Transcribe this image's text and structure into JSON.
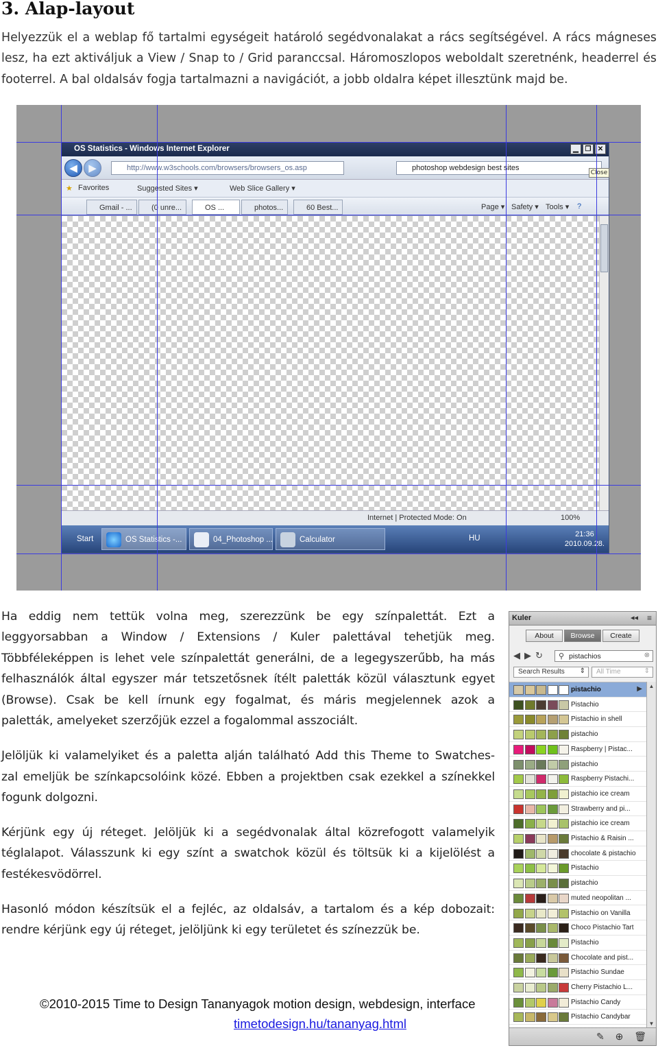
{
  "heading": "3. Alap-layout",
  "intro": [
    "Helyezzük el a weblap fő tartalmi egységeit határoló segédvonalakat a rács segítségével. A rács mágneses",
    "lesz, ha ezt aktiváljuk a View / Snap to / Grid paranccsal. Háromoszlopos weboldalt szeretnénk, headerrel és",
    "footerrel. A bal oldalsáv fogja tartalmazni a navigációt, a jobb oldalra képet illesztünk majd be."
  ],
  "screenshot": {
    "window_title": "OS Statistics - Windows Internet Explorer",
    "address": "http://www.w3schools.com/browsers/browsers_os.asp",
    "search_text": "photoshop webdesign best sites",
    "close_tooltip": "Close",
    "favorites": [
      "Favorites",
      "Suggested Sites ▾",
      "Web Slice Gallery ▾"
    ],
    "tabs": [
      "Gmail - ...",
      "(0 unre...",
      "OS ...",
      "photos...",
      "60 Best..."
    ],
    "commands": [
      "Page ▾",
      "Safety ▾",
      "Tools ▾"
    ],
    "status_zone": "Internet | Protected Mode: On",
    "status_zoom": "100%",
    "taskbar": {
      "start": "Start",
      "items": [
        "OS Statistics -...",
        "04_Photoshop ...",
        "Calculator"
      ],
      "lang": "HU",
      "time": "21:36",
      "date": "2010.09.28."
    }
  },
  "paragraphs": [
    [
      "Ha eddig nem tettük volna meg, szerezzünk be egy színpalettát. Ezt a",
      "leggyorsabban a Window / Extensions / Kuler palettával tehetjük meg.",
      "Többféleképpen is lehet vele színpalettát generálni, de a legegyszerűbb, ha más",
      "felhasználók által egyszer már tetszetősnek ítélt paletták közül választunk egyet",
      "(Browse). Csak be kell írnunk egy fogalmat, és máris megjelennek azok a",
      "paletták, amelyeket szerzőjük ezzel a fogalommal asszociált."
    ],
    [
      "Jelöljük ki valamelyiket és a paletta alján található Add this Theme to Swatches-",
      "zal emeljük be színkapcsolóink közé. Ebben a projektben csak ezekkel a színekkel",
      "fogunk dolgozni."
    ],
    [
      "Kérjünk egy új réteget. Jelöljük ki a segédvonalak által közrefogott valamelyik",
      "téglalapot. Válasszunk ki egy színt a swatchok közül és töltsük ki a kijelölést a",
      "festékesvödörrel."
    ],
    [
      "Hasonló módon készítsük el a fejléc, az oldalsáv, a tartalom és a kép dobozait:",
      "rendre kérjünk egy új réteget, jelöljünk ki egy területet és színezzük be."
    ]
  ],
  "kuler": {
    "panel_title": "Kuler",
    "panel_arrows": "◂◂",
    "tabs": [
      "About",
      "Browse",
      "Create"
    ],
    "selected_tab": "Browse",
    "search_value": "pistachios",
    "filter_left": "Search Results",
    "filter_right": "All Time",
    "themes": [
      {
        "name": "pistachio",
        "colors": [
          "#d6c9a8",
          "#d9c79a",
          "#c8b98f",
          "#ffffff",
          "#ffffff"
        ]
      },
      {
        "name": "Pistachio",
        "colors": [
          "#3d5020",
          "#6f7a2c",
          "#4b3d32",
          "#7a4b5a",
          "#c9c8a6"
        ]
      },
      {
        "name": "Pistachio in shell",
        "colors": [
          "#9a9a3a",
          "#8a8a2c",
          "#b8a25a",
          "#b59f72",
          "#d4c694"
        ]
      },
      {
        "name": "pistachio",
        "colors": [
          "#c3d27c",
          "#b9ca6e",
          "#a3b55a",
          "#8da04a",
          "#6f8236"
        ]
      },
      {
        "name": "Raspberry | Pistac...",
        "colors": [
          "#e81b7a",
          "#c20d5e",
          "#8ad321",
          "#6fc11b",
          "#f5f3ea"
        ]
      },
      {
        "name": "pistachio",
        "colors": [
          "#7d8f6c",
          "#9aab85",
          "#6a7a5b",
          "#c1cba8",
          "#8fa07a"
        ]
      },
      {
        "name": "Raspberry Pistachi...",
        "colors": [
          "#a3c94a",
          "#e3e3d8",
          "#d02a6b",
          "#f2f2ec",
          "#8dbb3a"
        ]
      },
      {
        "name": "pistachio ice cream",
        "colors": [
          "#c6dc8e",
          "#a8c85f",
          "#94b44a",
          "#7f9f3a",
          "#f0f1d0"
        ]
      },
      {
        "name": "Strawberry and pi...",
        "colors": [
          "#c9342f",
          "#e8b7a8",
          "#9dc55b",
          "#6a9a3a",
          "#f2efe0"
        ]
      },
      {
        "name": "pistachio ice cream",
        "colors": [
          "#4d6d2a",
          "#8ab04a",
          "#c6d88a",
          "#f2f1d0",
          "#a8c26a"
        ]
      },
      {
        "name": "Pistachio & Raisin ...",
        "colors": [
          "#b7d06a",
          "#8a3a5a",
          "#e8e4c8",
          "#b79a6a",
          "#6a7a3a"
        ]
      },
      {
        "name": "chocolate & pistachio",
        "colors": [
          "#1f1a16",
          "#9fb86a",
          "#cfd8a8",
          "#f0ede0",
          "#4a3a2a"
        ]
      },
      {
        "name": "Pistachio",
        "colors": [
          "#a9d25a",
          "#8ec047",
          "#d5e89a",
          "#f3f6d8",
          "#6a9a2a"
        ]
      },
      {
        "name": "pistachio",
        "colors": [
          "#dbe6b4",
          "#b9cc8a",
          "#9cb06a",
          "#7a8f4a",
          "#5a6f3a"
        ]
      },
      {
        "name": "muted neopolitan ...",
        "colors": [
          "#6b8a3a",
          "#b63a3a",
          "#2a1f1a",
          "#d9c9a8",
          "#e8d6c8"
        ]
      },
      {
        "name": "Pistachio on Vanilla",
        "colors": [
          "#93a84a",
          "#c7d38a",
          "#e8e8c8",
          "#f2efd8",
          "#b2c26a"
        ]
      },
      {
        "name": "Choco Pistachio Tart",
        "colors": [
          "#3a2a1f",
          "#5a4a2a",
          "#7a8f4a",
          "#a9b86a",
          "#2a1f16"
        ]
      },
      {
        "name": "Pistachio",
        "colors": [
          "#a0b85a",
          "#88a04a",
          "#c8d89a",
          "#6a8a3a",
          "#e4ecc8"
        ]
      },
      {
        "name": "Chocolate and pist...",
        "colors": [
          "#6a7a3a",
          "#9aaa5a",
          "#3a2a1f",
          "#c8c89a",
          "#7a5a3a"
        ]
      },
      {
        "name": "Pistachio Sundae",
        "colors": [
          "#8fb84a",
          "#f2f2e0",
          "#c8dca0",
          "#6a9a3a",
          "#e8e0c8"
        ]
      },
      {
        "name": "Cherry Pistachio L...",
        "colors": [
          "#c9d2a0",
          "#e8ecd0",
          "#b8c888",
          "#9aaa6a",
          "#c83a3a"
        ]
      },
      {
        "name": "Pistachio Candy",
        "colors": [
          "#6a8f3a",
          "#b2c86a",
          "#e0d04a",
          "#c87a9a",
          "#f2ecd8"
        ]
      },
      {
        "name": "Pistachio Candybar",
        "colors": [
          "#a8b85a",
          "#c8b86a",
          "#8a6a3a",
          "#d8c88a",
          "#6a7a3a"
        ]
      }
    ],
    "footer_icons": "✎ ⊕ 🗑"
  },
  "footer": {
    "copyright": "©2010-2015 Time to Design Tananyagok motion design, webdesign, interface",
    "link": "timetodesign.hu/tananyag.html"
  }
}
